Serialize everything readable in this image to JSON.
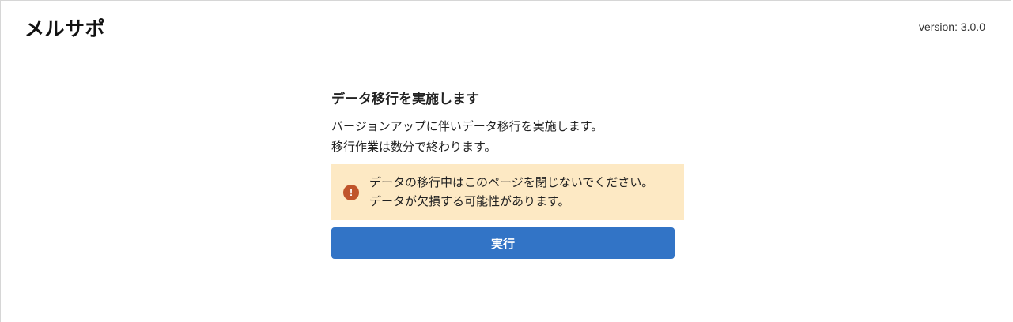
{
  "header": {
    "logo_text": "メルサポ",
    "version_text": "version: 3.0.0"
  },
  "main": {
    "title": "データ移行を実施します",
    "description_lines": [
      "バージョンアップに伴いデータ移行を実施します。",
      "移行作業は数分で終わります。"
    ],
    "alert": {
      "icon": "exclamation-circle-icon",
      "icon_glyph": "!",
      "lines": [
        "データの移行中はこのページを閉じないでください。",
        "データが欠損する可能性があります。"
      ]
    },
    "run_button_label": "実行"
  },
  "colors": {
    "alert_background": "#fde9c4",
    "alert_icon": "#c0542b",
    "button": "#3274c6"
  }
}
